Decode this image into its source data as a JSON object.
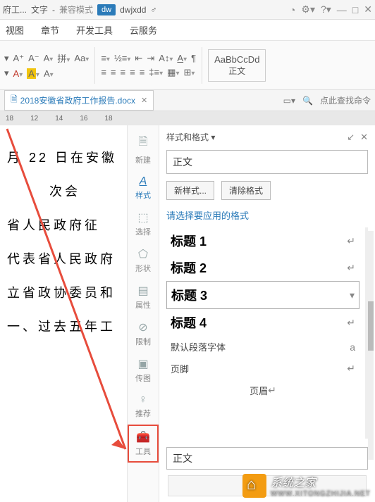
{
  "titlebar": {
    "doc_short": "府工...",
    "app_label": "文字",
    "compat": "兼容模式",
    "tab_label": "dw",
    "user": "dwjxdd"
  },
  "menurow": [
    "视图",
    "章节",
    "开发工具",
    "云服务"
  ],
  "ribbon": {
    "style_big": "AaBbCcDd",
    "style_small": "正文"
  },
  "filetab": {
    "name": "2018安徽省政府工作报告.docx",
    "search": "点此查找命令"
  },
  "ruler": [
    "18",
    "12",
    "14",
    "16",
    "18"
  ],
  "doc_lines": [
    "月 22 日在安徽",
    "次会",
    "省人民政府征",
    "",
    "代表省人民政府",
    "立省政协委员和",
    "",
    "一、过去五年工"
  ],
  "siderail": [
    {
      "icon": "📄",
      "label": "新建"
    },
    {
      "icon": "A",
      "label": "样式"
    },
    {
      "icon": "⬚",
      "label": "选择"
    },
    {
      "icon": "◆",
      "label": "形状"
    },
    {
      "icon": "≣",
      "label": "属性"
    },
    {
      "icon": "⊘",
      "label": "限制"
    },
    {
      "icon": "🖼",
      "label": "传图"
    },
    {
      "icon": "♡",
      "label": "推荐"
    },
    {
      "icon": "🧰",
      "label": "工具"
    }
  ],
  "panel": {
    "title": "样式和格式",
    "current": "正文",
    "btn_new": "新样式...",
    "btn_clear": "清除格式",
    "hint": "请选择要应用的格式",
    "styles": [
      {
        "name": "标题 1",
        "mark": "↵",
        "cls": ""
      },
      {
        "name": "标题 2",
        "mark": "↵",
        "cls": ""
      },
      {
        "name": "标题 3",
        "mark": "▾",
        "cls": "selected"
      },
      {
        "name": "标题 4",
        "mark": "↵",
        "cls": ""
      },
      {
        "name": "默认段落字体",
        "mark": "a",
        "cls": "small"
      },
      {
        "name": "页脚",
        "mark": "↵",
        "cls": "small"
      },
      {
        "name": "页眉",
        "mark": "↵",
        "cls": "small center"
      }
    ],
    "apply": "正文"
  },
  "watermark": {
    "brand": "系统之家",
    "url": "WWW.XITONGZHIJIA.NET"
  }
}
